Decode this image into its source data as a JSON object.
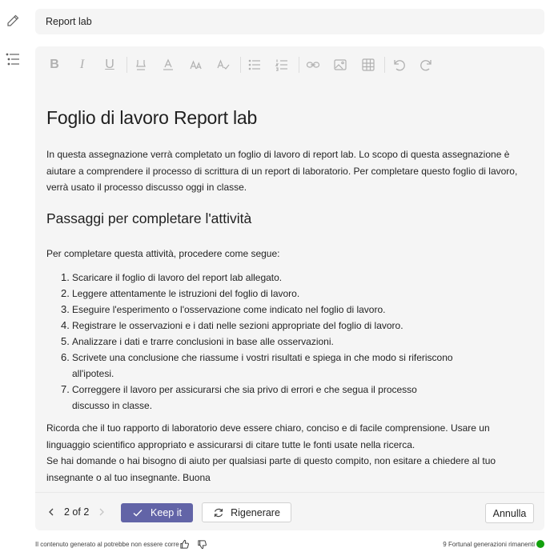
{
  "title_field": {
    "value": "Report lab"
  },
  "icons": {
    "edit": "pencil-icon",
    "outline": "list-outline-icon"
  },
  "toolbar": {
    "items": [
      "bold",
      "italic",
      "underline",
      "highlight",
      "font-color",
      "font-size",
      "text-style",
      "bullet-list",
      "numbered-list",
      "link",
      "image",
      "table",
      "undo",
      "redo"
    ],
    "bold_glyph": "B",
    "italic_glyph": "I",
    "underline_glyph": "U"
  },
  "document": {
    "title": "Foglio di lavoro Report lab",
    "intro": "In questa assegnazione verrà completato un foglio di lavoro di report lab. Lo scopo di questa assegnazione è aiutare a comprendere il processo di scrittura di un report di laboratorio. Per completare questo foglio di lavoro, verrà usato il processo discusso oggi in classe.",
    "heading": "Passaggi per completare l'attività",
    "lead": "Per completare questa attività, procedere come segue:",
    "steps": [
      {
        "num": "1.",
        "text": "Scaricare il foglio di lavoro del report lab allegato."
      },
      {
        "num": "2.",
        "text": "Leggere attentamente le istruzioni del foglio di lavoro."
      },
      {
        "num": "3.",
        "text": "Eseguire l'esperimento o l'osservazione come indicato nel foglio di lavoro."
      },
      {
        "num": "4.",
        "text": "Registrare le osservazioni e i dati nelle sezioni appropriate del foglio di lavoro."
      },
      {
        "num": "5.",
        "text": "Analizzare i dati e trarre conclusioni in base alle osservazioni."
      },
      {
        "num": "6.",
        "text": "Scrivete una conclusione che riassume i vostri risultati e spiega in che modo si riferiscono all'ipotesi."
      },
      {
        "num": "7.",
        "text": "Correggere il lavoro per assicurarsi che sia privo di errori e che segua il processo discusso in classe."
      }
    ],
    "closing_1": "Ricorda che il tuo rapporto di laboratorio deve essere chiaro, conciso e di facile comprensione. Usare un linguaggio scientifico appropriato e assicurarsi di citare tutte le fonti usate nella ricerca.",
    "closing_2": "Se hai domande o hai bisogno di aiuto per qualsiasi parte di questo compito, non esitare a chiedere al tuo insegnante o al tuo insegnante. Buona"
  },
  "actions": {
    "pager": "2 of 2",
    "keep_label": "Keep it",
    "regen_label": "Rigenerare",
    "cancel_label": "Annulla",
    "accent_color": "#6264a7"
  },
  "footer": {
    "disclaimer": "Il contenuto generato al potrebbe non essere corre",
    "remaining": "9 Fortunal generazioni rimanenti",
    "status_color": "#13a10e"
  }
}
